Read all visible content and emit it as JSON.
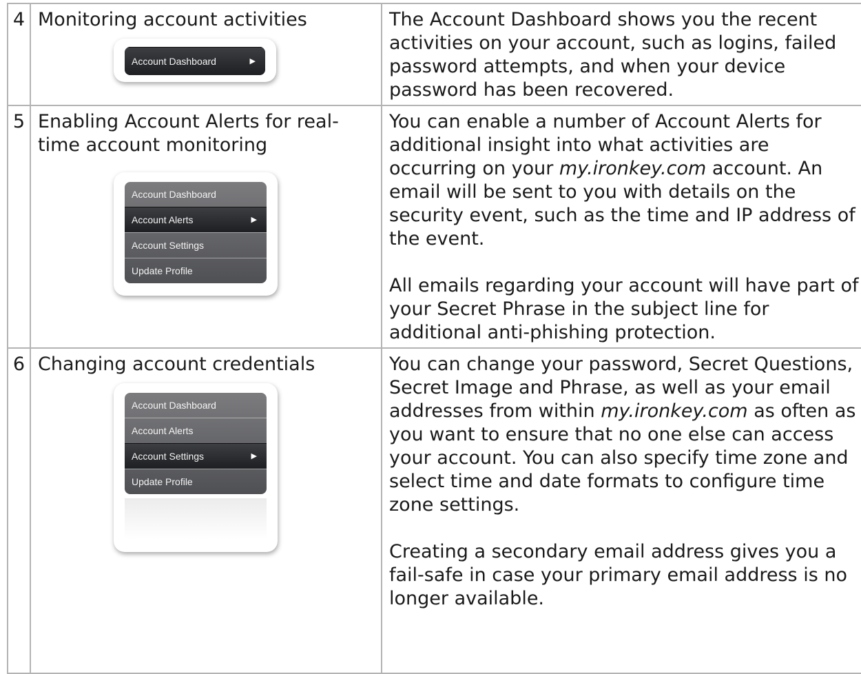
{
  "rows": [
    {
      "num": "4",
      "topic": "Monitoring account activities",
      "menu": [
        "Account Dashboard"
      ],
      "description": [
        "The Account Dashboard shows you the recent activities on your account, such as logins, failed password attempts, and when your device password has been recovered."
      ]
    },
    {
      "num": "5",
      "topic": "Enabling Account Alerts for real-time account monitoring",
      "menu": [
        "Account Dashboard",
        "Account Alerts",
        "Account Settings",
        "Update Profile"
      ],
      "description": [
        {
          "pre": "You can enable a number of Account Alerts for additional insight into what activities are occurring on your ",
          "link": "my.ironkey.com",
          "post": " account.  An email will be sent to you with details on the security event, such as the time and IP address of the event."
        },
        "All emails regarding your account will have part of your Secret Phrase in the subject line for additional anti-phishing protection."
      ]
    },
    {
      "num": "6",
      "topic": "Changing account credentials",
      "menu": [
        "Account Dashboard",
        "Account Alerts",
        "Account Settings",
        "Update Profile"
      ],
      "description": [
        {
          "pre": "You can change your password, Secret Questions, Secret Image and Phrase, as well as your email addresses from within ",
          "link": "my.ironkey.com",
          "post": " as often as you want to ensure that no one else can access your account. You can also specify time zone and select time and date formats to configure time zone settings."
        },
        "Creating a secondary email address gives you a fail-safe in case your primary email address is no longer available."
      ]
    }
  ],
  "icons": {
    "menu_arrow": "right-triangle-icon"
  }
}
